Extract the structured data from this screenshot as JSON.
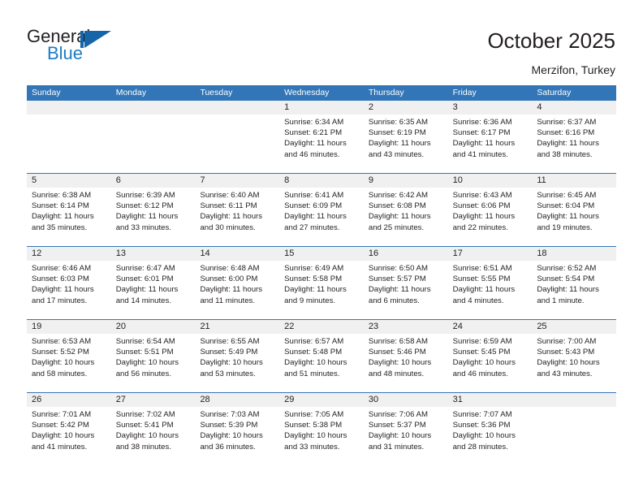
{
  "brand": {
    "word_one": "General",
    "word_two": "Blue",
    "mark": "triangle-logo",
    "accent_color": "#1d7cc4",
    "mark_color": "#1565a8"
  },
  "header": {
    "title": "October 2025",
    "subtitle": "Merzifon, Turkey"
  },
  "calendar": {
    "header_bg": "#3276b8",
    "daynum_bg": "#f0f0f0",
    "weekday_headers": [
      "Sunday",
      "Monday",
      "Tuesday",
      "Wednesday",
      "Thursday",
      "Friday",
      "Saturday"
    ],
    "weeks": [
      [
        {
          "day": "",
          "sunrise": "",
          "sunset": "",
          "daylight_line1": "",
          "daylight_line2": ""
        },
        {
          "day": "",
          "sunrise": "",
          "sunset": "",
          "daylight_line1": "",
          "daylight_line2": ""
        },
        {
          "day": "",
          "sunrise": "",
          "sunset": "",
          "daylight_line1": "",
          "daylight_line2": ""
        },
        {
          "day": "1",
          "sunrise": "Sunrise: 6:34 AM",
          "sunset": "Sunset: 6:21 PM",
          "daylight_line1": "Daylight: 11 hours",
          "daylight_line2": "and 46 minutes."
        },
        {
          "day": "2",
          "sunrise": "Sunrise: 6:35 AM",
          "sunset": "Sunset: 6:19 PM",
          "daylight_line1": "Daylight: 11 hours",
          "daylight_line2": "and 43 minutes."
        },
        {
          "day": "3",
          "sunrise": "Sunrise: 6:36 AM",
          "sunset": "Sunset: 6:17 PM",
          "daylight_line1": "Daylight: 11 hours",
          "daylight_line2": "and 41 minutes."
        },
        {
          "day": "4",
          "sunrise": "Sunrise: 6:37 AM",
          "sunset": "Sunset: 6:16 PM",
          "daylight_line1": "Daylight: 11 hours",
          "daylight_line2": "and 38 minutes."
        }
      ],
      [
        {
          "day": "5",
          "sunrise": "Sunrise: 6:38 AM",
          "sunset": "Sunset: 6:14 PM",
          "daylight_line1": "Daylight: 11 hours",
          "daylight_line2": "and 35 minutes."
        },
        {
          "day": "6",
          "sunrise": "Sunrise: 6:39 AM",
          "sunset": "Sunset: 6:12 PM",
          "daylight_line1": "Daylight: 11 hours",
          "daylight_line2": "and 33 minutes."
        },
        {
          "day": "7",
          "sunrise": "Sunrise: 6:40 AM",
          "sunset": "Sunset: 6:11 PM",
          "daylight_line1": "Daylight: 11 hours",
          "daylight_line2": "and 30 minutes."
        },
        {
          "day": "8",
          "sunrise": "Sunrise: 6:41 AM",
          "sunset": "Sunset: 6:09 PM",
          "daylight_line1": "Daylight: 11 hours",
          "daylight_line2": "and 27 minutes."
        },
        {
          "day": "9",
          "sunrise": "Sunrise: 6:42 AM",
          "sunset": "Sunset: 6:08 PM",
          "daylight_line1": "Daylight: 11 hours",
          "daylight_line2": "and 25 minutes."
        },
        {
          "day": "10",
          "sunrise": "Sunrise: 6:43 AM",
          "sunset": "Sunset: 6:06 PM",
          "daylight_line1": "Daylight: 11 hours",
          "daylight_line2": "and 22 minutes."
        },
        {
          "day": "11",
          "sunrise": "Sunrise: 6:45 AM",
          "sunset": "Sunset: 6:04 PM",
          "daylight_line1": "Daylight: 11 hours",
          "daylight_line2": "and 19 minutes."
        }
      ],
      [
        {
          "day": "12",
          "sunrise": "Sunrise: 6:46 AM",
          "sunset": "Sunset: 6:03 PM",
          "daylight_line1": "Daylight: 11 hours",
          "daylight_line2": "and 17 minutes."
        },
        {
          "day": "13",
          "sunrise": "Sunrise: 6:47 AM",
          "sunset": "Sunset: 6:01 PM",
          "daylight_line1": "Daylight: 11 hours",
          "daylight_line2": "and 14 minutes."
        },
        {
          "day": "14",
          "sunrise": "Sunrise: 6:48 AM",
          "sunset": "Sunset: 6:00 PM",
          "daylight_line1": "Daylight: 11 hours",
          "daylight_line2": "and 11 minutes."
        },
        {
          "day": "15",
          "sunrise": "Sunrise: 6:49 AM",
          "sunset": "Sunset: 5:58 PM",
          "daylight_line1": "Daylight: 11 hours",
          "daylight_line2": "and 9 minutes."
        },
        {
          "day": "16",
          "sunrise": "Sunrise: 6:50 AM",
          "sunset": "Sunset: 5:57 PM",
          "daylight_line1": "Daylight: 11 hours",
          "daylight_line2": "and 6 minutes."
        },
        {
          "day": "17",
          "sunrise": "Sunrise: 6:51 AM",
          "sunset": "Sunset: 5:55 PM",
          "daylight_line1": "Daylight: 11 hours",
          "daylight_line2": "and 4 minutes."
        },
        {
          "day": "18",
          "sunrise": "Sunrise: 6:52 AM",
          "sunset": "Sunset: 5:54 PM",
          "daylight_line1": "Daylight: 11 hours",
          "daylight_line2": "and 1 minute."
        }
      ],
      [
        {
          "day": "19",
          "sunrise": "Sunrise: 6:53 AM",
          "sunset": "Sunset: 5:52 PM",
          "daylight_line1": "Daylight: 10 hours",
          "daylight_line2": "and 58 minutes."
        },
        {
          "day": "20",
          "sunrise": "Sunrise: 6:54 AM",
          "sunset": "Sunset: 5:51 PM",
          "daylight_line1": "Daylight: 10 hours",
          "daylight_line2": "and 56 minutes."
        },
        {
          "day": "21",
          "sunrise": "Sunrise: 6:55 AM",
          "sunset": "Sunset: 5:49 PM",
          "daylight_line1": "Daylight: 10 hours",
          "daylight_line2": "and 53 minutes."
        },
        {
          "day": "22",
          "sunrise": "Sunrise: 6:57 AM",
          "sunset": "Sunset: 5:48 PM",
          "daylight_line1": "Daylight: 10 hours",
          "daylight_line2": "and 51 minutes."
        },
        {
          "day": "23",
          "sunrise": "Sunrise: 6:58 AM",
          "sunset": "Sunset: 5:46 PM",
          "daylight_line1": "Daylight: 10 hours",
          "daylight_line2": "and 48 minutes."
        },
        {
          "day": "24",
          "sunrise": "Sunrise: 6:59 AM",
          "sunset": "Sunset: 5:45 PM",
          "daylight_line1": "Daylight: 10 hours",
          "daylight_line2": "and 46 minutes."
        },
        {
          "day": "25",
          "sunrise": "Sunrise: 7:00 AM",
          "sunset": "Sunset: 5:43 PM",
          "daylight_line1": "Daylight: 10 hours",
          "daylight_line2": "and 43 minutes."
        }
      ],
      [
        {
          "day": "26",
          "sunrise": "Sunrise: 7:01 AM",
          "sunset": "Sunset: 5:42 PM",
          "daylight_line1": "Daylight: 10 hours",
          "daylight_line2": "and 41 minutes."
        },
        {
          "day": "27",
          "sunrise": "Sunrise: 7:02 AM",
          "sunset": "Sunset: 5:41 PM",
          "daylight_line1": "Daylight: 10 hours",
          "daylight_line2": "and 38 minutes."
        },
        {
          "day": "28",
          "sunrise": "Sunrise: 7:03 AM",
          "sunset": "Sunset: 5:39 PM",
          "daylight_line1": "Daylight: 10 hours",
          "daylight_line2": "and 36 minutes."
        },
        {
          "day": "29",
          "sunrise": "Sunrise: 7:05 AM",
          "sunset": "Sunset: 5:38 PM",
          "daylight_line1": "Daylight: 10 hours",
          "daylight_line2": "and 33 minutes."
        },
        {
          "day": "30",
          "sunrise": "Sunrise: 7:06 AM",
          "sunset": "Sunset: 5:37 PM",
          "daylight_line1": "Daylight: 10 hours",
          "daylight_line2": "and 31 minutes."
        },
        {
          "day": "31",
          "sunrise": "Sunrise: 7:07 AM",
          "sunset": "Sunset: 5:36 PM",
          "daylight_line1": "Daylight: 10 hours",
          "daylight_line2": "and 28 minutes."
        },
        {
          "day": "",
          "sunrise": "",
          "sunset": "",
          "daylight_line1": "",
          "daylight_line2": ""
        }
      ]
    ]
  }
}
